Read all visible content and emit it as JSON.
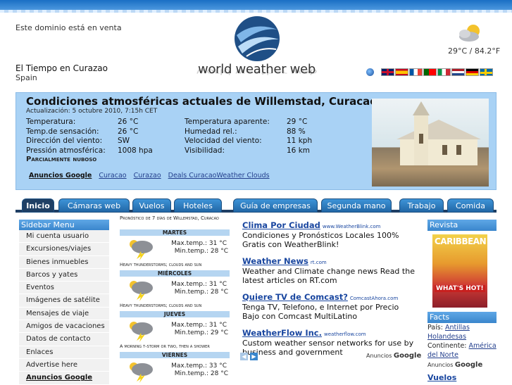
{
  "header": {
    "sale_text": "Este dominio está en venta",
    "city_title": "El Tiempo en Curazao",
    "city_sub": "Spain",
    "logo_text": "world weather web",
    "current_temp": "29°C / 84.2°F"
  },
  "flags": [
    "United Kingdom",
    "Spain",
    "France",
    "Portugal",
    "Italy",
    "Netherlands",
    "Germany",
    "Sweden"
  ],
  "current": {
    "title": "Condiciones atmosféricas actuales de Willemstad, Curacao",
    "updated": "Actualización: 5 octubre 2010, 7:15h CET",
    "rows": [
      {
        "l1": "Temperatura:",
        "v1": "26 °C",
        "l2": "Temperatura aparente:",
        "v2": "29 °C"
      },
      {
        "l1": "Temp.de sensación:",
        "v1": "26 °C",
        "l2": "Humedad rel.:",
        "v2": "88 %"
      },
      {
        "l1": "Dirección del viento:",
        "v1": "SW",
        "l2": "Velocidad del viento:",
        "v2": "11 kph"
      },
      {
        "l1": "Pressión atmosférica:",
        "v1": "1008 hpa",
        "l2": "Visibilidad:",
        "v2": "16 km"
      }
    ],
    "condition": "Parcialmente nuboso",
    "ads_label": "Anuncios Google",
    "ad_links": [
      "Curacao",
      "Curazao",
      "Deals Curacao",
      "Weather Clouds"
    ]
  },
  "nav": {
    "tabs": [
      "Inicio",
      "Cámaras web",
      "Vuelos",
      "Hoteles",
      "Guía de empresas",
      "Segunda mano",
      "Trabajo",
      "Comida"
    ],
    "active": "Inicio"
  },
  "sidebar": {
    "title": "Sidebar Menu",
    "items": [
      "Mi cuenta usuario",
      "Excursiones/viajes",
      "Bienes inmuebles",
      "Barcos y yates",
      "Eventos",
      "Imágenes de satélite",
      "Mensajes de viaje",
      "Amigos de vacaciones",
      "Datos de contacto",
      "Enlaces",
      "Advertise here",
      "Anuncios Google"
    ]
  },
  "forecast": {
    "title": "Pronóstico de 7 días de Willemstad, Curacao",
    "days": [
      {
        "day": "MARTES",
        "max": "Max.temp.: 31 °C",
        "min": "Min.temp.: 28 °C",
        "desc": "Heavy thunderstorms; clouds and sun"
      },
      {
        "day": "MIÉRCOLES",
        "max": "Max.temp.: 31 °C",
        "min": "Min.temp.: 28 °C",
        "desc": "Heavy thunderstorms; clouds and sun"
      },
      {
        "day": "JUEVES",
        "max": "Max.temp.: 31 °C",
        "min": "Min.temp.: 29 °C",
        "desc": "A morning t-storm or two, then a shower"
      },
      {
        "day": "VIERNES",
        "max": "Max.temp.: 33 °C",
        "min": "Min.temp.: 28 °C",
        "desc": ""
      }
    ]
  },
  "ads": [
    {
      "title": "Clima Por Ciudad",
      "url": "www.WeatherBlink.com",
      "desc": "Condiciones y Pronósticos Locales 100% Gratis con WeatherBlink!"
    },
    {
      "title": "Weather News",
      "url": "rt.com",
      "desc": "Weather and Climate change news Read the latest articles on RT.com"
    },
    {
      "title": "Quiere TV de Comcast?",
      "url": "ComcastAhora.com",
      "desc": "Tenga TV, Telefono, e Internet por Precio Bajo con Comcast MultiLatino"
    },
    {
      "title": "WeatherFlow Inc.",
      "url": "weatherflow.com",
      "desc": "Custom weather sensor networks for use by business and government"
    }
  ],
  "ads_by": "Anuncios",
  "ads_google": "Google",
  "right": {
    "revista": "Revista",
    "mag_title": "CARIBBEAN",
    "mag_hot": "WHAT'S HOT!",
    "facts": "Facts",
    "pais_label": "País:",
    "pais": "Antillas Holandesas",
    "continente_label": "Continente:",
    "continente": "América del Norte",
    "ads_by": "Anuncios",
    "ads_google": "Google",
    "vuelos": "Vuelos"
  }
}
